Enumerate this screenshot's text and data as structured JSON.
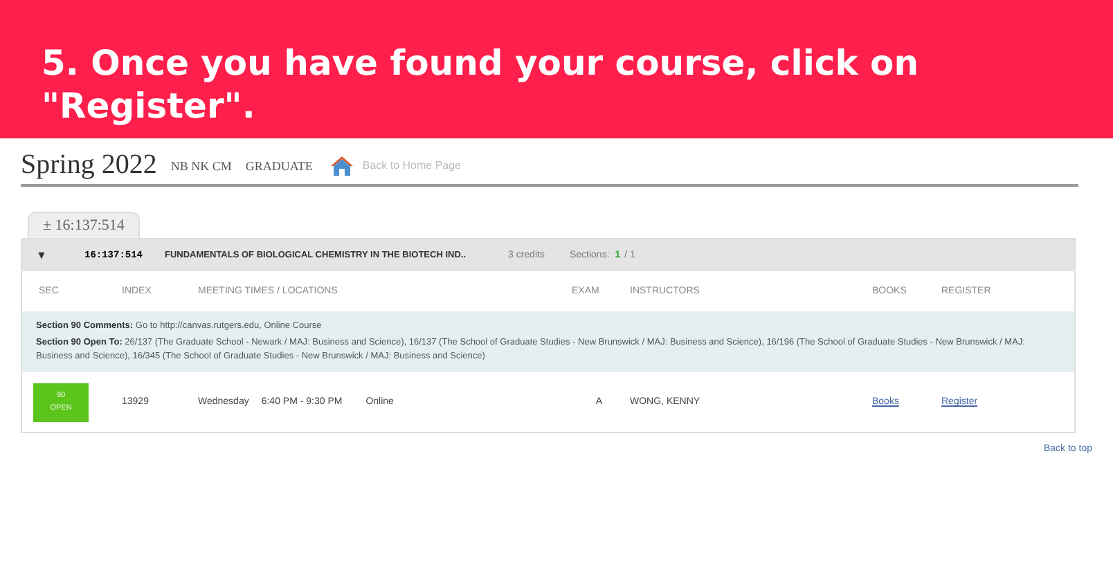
{
  "banner": {
    "title": "5. Once you have found your course, click on \"Register\"."
  },
  "term": {
    "title": "Spring 2022",
    "campuses": "NB NK CM",
    "level": "GRADUATE",
    "home_link": "Back to Home Page"
  },
  "tab": {
    "icon": "±",
    "label": "16:137:514"
  },
  "course": {
    "toggle": "▼",
    "code": "16:137:514",
    "title": "FUNDAMENTALS OF BIOLOGICAL CHEMISTRY IN THE BIOTECH IND..",
    "credits": "3 credits",
    "sections_label": "Sections:",
    "sections_open": "1",
    "sections_total": "/ 1"
  },
  "columns": [
    "SEC",
    "INDEX",
    "MEETING TIMES / LOCATIONS",
    "EXAM",
    "INSTRUCTORS",
    "BOOKS",
    "REGISTER"
  ],
  "comments": [
    "**Section 90 Comments:** Go to http://canvas.rutgers.edu, Online Course",
    "**Section 90 Open To:** 26/137 (The Graduate School - Newark / MAJ: Business and Science), 16/137 (The School of Graduate Studies - New Brunswick / MAJ: Business and Science), 16/196 (The School of Graduate Studies - New Brunswick / MAJ: Business and Science), 16/345 (The School of Graduate Studies - New Brunswick / MAJ: Business and Science)"
  ],
  "section": {
    "number": "90",
    "status": "OPEN",
    "index": "13929",
    "day": "Wednesday",
    "time": "6:40 PM - 9:30 PM",
    "location": "Online",
    "exam": "A",
    "instructor": "WONG, KENNY",
    "books": "Books",
    "register": "Register"
  },
  "back_to_top": "Back to top"
}
